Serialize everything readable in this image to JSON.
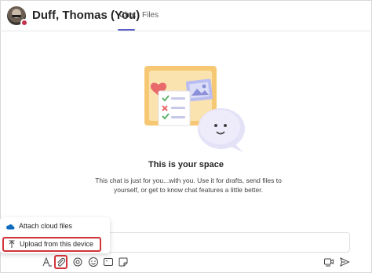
{
  "header": {
    "title": "Duff, Thomas (You)",
    "tabs": [
      {
        "label": "Chat",
        "active": true
      },
      {
        "label": "Files",
        "active": false
      }
    ],
    "presence_color": "#c4314b",
    "accent_color": "#5b5fc7"
  },
  "main": {
    "heading": "This is your space",
    "description": "This chat is just for you...with you. Use it for drafts, send files to yourself, or get to know chat features a little better."
  },
  "attach_menu": {
    "items": [
      {
        "label": "Attach cloud files",
        "icon": "onedrive-cloud-icon"
      },
      {
        "label": "Upload from this device",
        "icon": "upload-arrow-icon",
        "highlighted": true
      }
    ],
    "highlight_color": "#d13438"
  },
  "toolbar": {
    "icons": [
      "format-icon",
      "attach-icon",
      "loop-icon",
      "emoji-icon",
      "gif-icon",
      "sticker-icon",
      "schedule-meeting-icon",
      "send-icon"
    ]
  }
}
